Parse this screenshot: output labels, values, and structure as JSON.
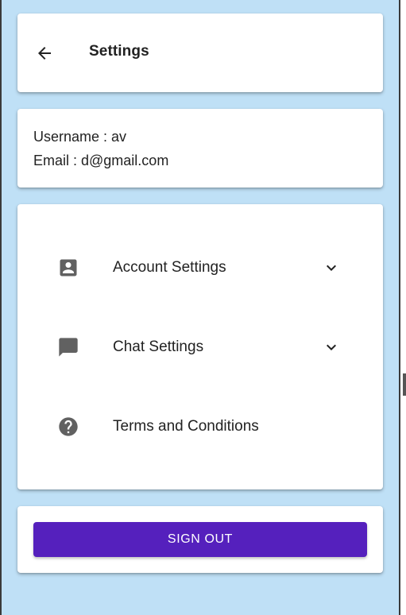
{
  "header": {
    "title": "Settings",
    "back_icon": "arrow-back-icon"
  },
  "user": {
    "username_line": "Username : av",
    "email_line": "Email : d@gmail.com"
  },
  "menu": {
    "items": [
      {
        "label": "Account Settings",
        "icon": "account-box-icon",
        "expandable": true
      },
      {
        "label": "Chat Settings",
        "icon": "chat-icon",
        "expandable": true
      },
      {
        "label": "Terms and Conditions",
        "icon": "help-circle-icon",
        "expandable": false
      }
    ]
  },
  "actions": {
    "sign_out_label": "SIGN OUT"
  },
  "colors": {
    "background": "#bfe0f6",
    "card": "#ffffff",
    "primary": "#5520bd",
    "icon": "#616161",
    "text": "#222222"
  }
}
